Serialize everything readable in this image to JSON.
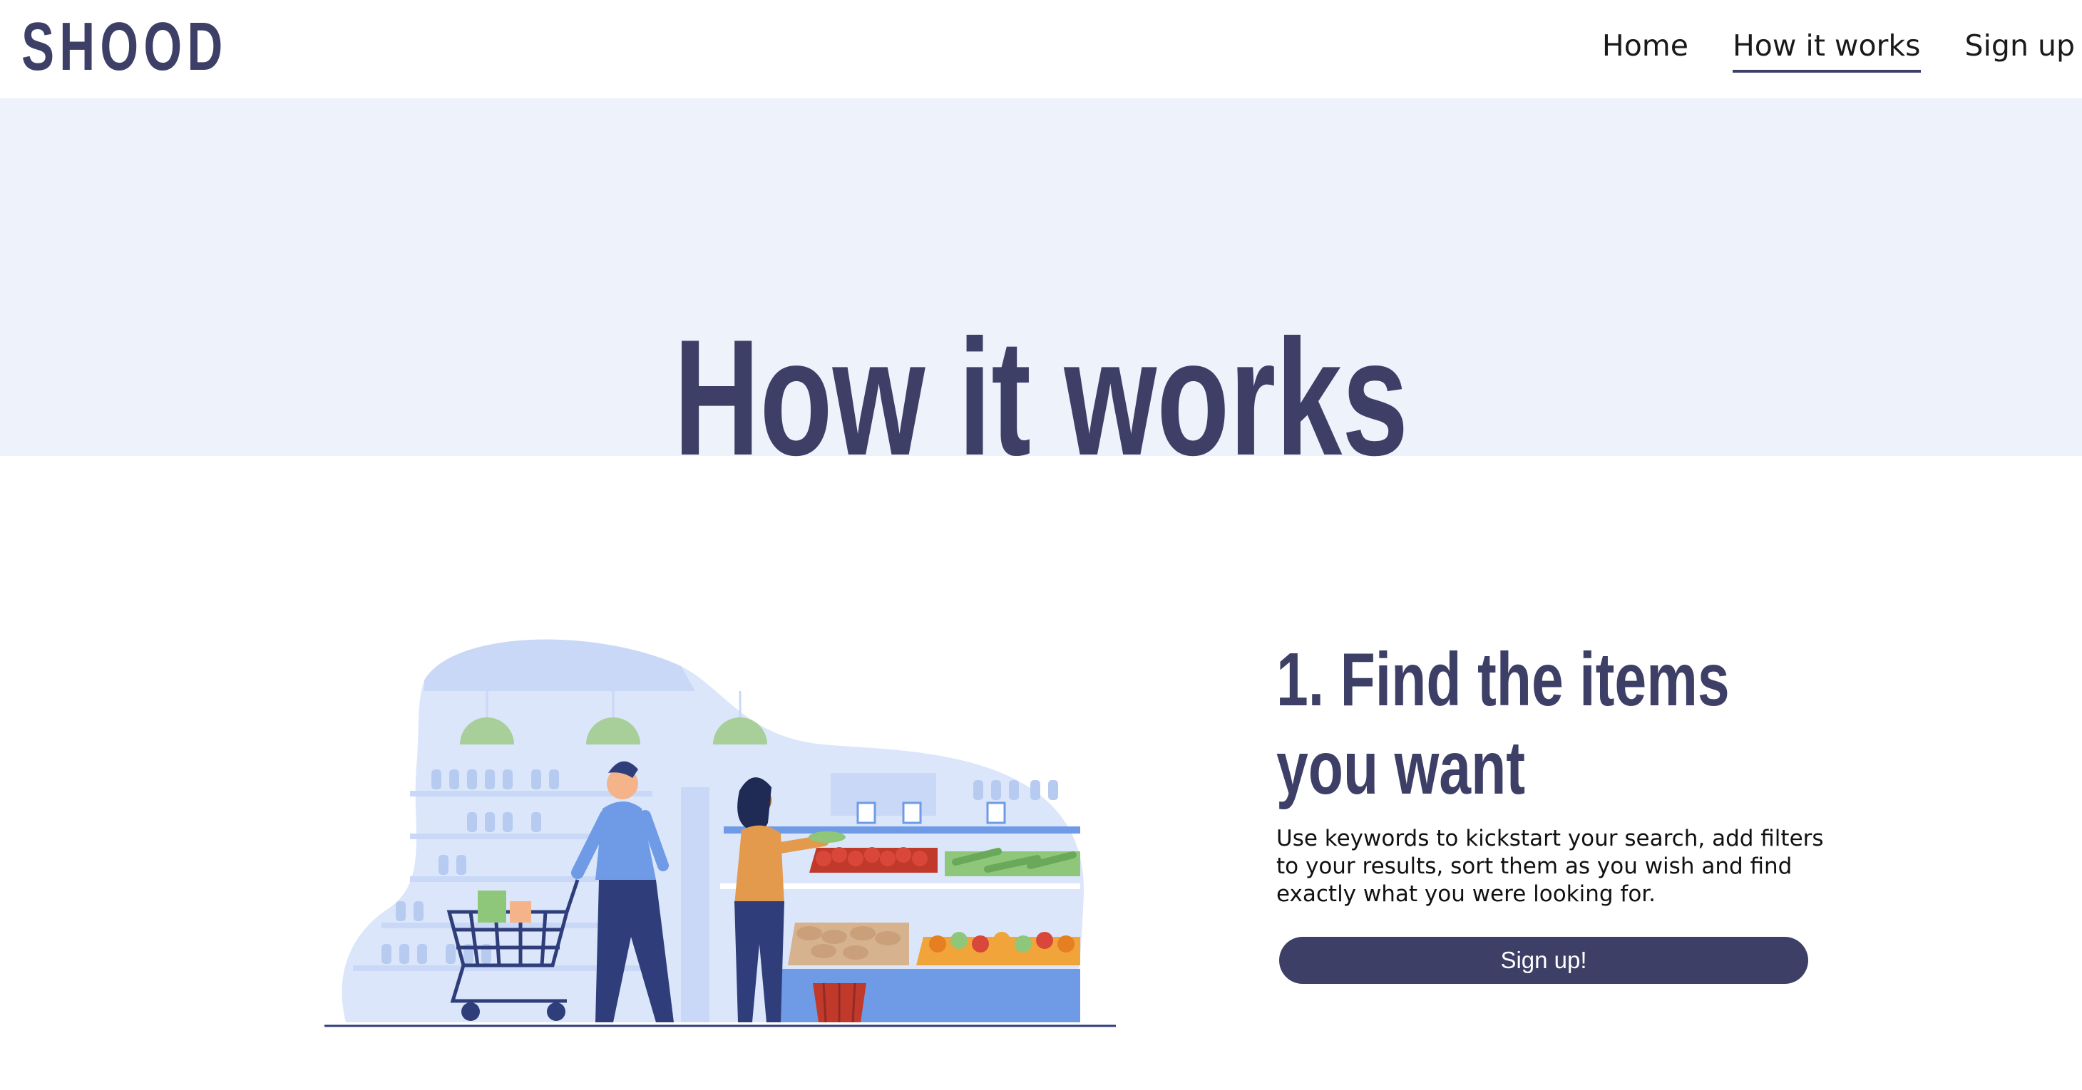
{
  "header": {
    "logo": "SHOOD",
    "nav": [
      {
        "label": "Home"
      },
      {
        "label": "How it works",
        "active": true
      },
      {
        "label": "Sign up"
      }
    ]
  },
  "hero": {
    "title": "How it works"
  },
  "step1": {
    "title": "1. Find the items you want",
    "description": "Use keywords to kickstart your search, add filters to your results, sort them as you wish and find exactly what you were looking for.",
    "button_label": "Sign up!",
    "illustration": "supermarket-shoppers-illustration"
  },
  "colors": {
    "brand": "#3d3f66",
    "hero_bg": "#eef2fb",
    "illustration_blue": "#6f9be6",
    "illustration_light": "#dbe6fb"
  }
}
